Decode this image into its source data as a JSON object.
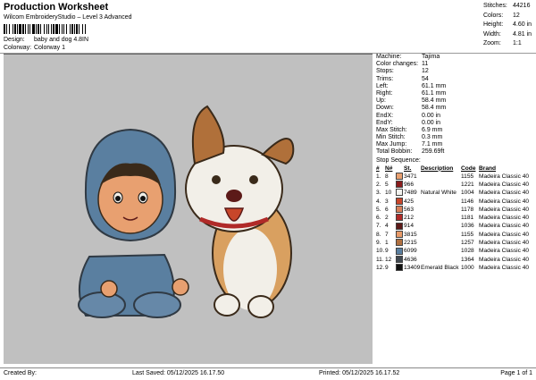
{
  "header": {
    "title": "Production Worksheet",
    "subtitle": "Wilcom EmbroideryStudio – Level 3 Advanced",
    "barcode_text": "",
    "design_label": "Design:",
    "design_value": "baby and dog 4.8IN",
    "colorway_label": "Colorway:",
    "colorway_value": "Colorway 1"
  },
  "stats": [
    {
      "k": "Stitches:",
      "v": "44216"
    },
    {
      "k": "Colors:",
      "v": "12"
    },
    {
      "k": "Height:",
      "v": "4.60 in"
    },
    {
      "k": "Width:",
      "v": "4.81 in"
    },
    {
      "k": "Zoom:",
      "v": "1:1"
    }
  ],
  "properties": [
    {
      "k": "Machine:",
      "v": "Tajima"
    },
    {
      "k": "Color changes:",
      "v": "11"
    },
    {
      "k": "Stops:",
      "v": "12"
    },
    {
      "k": "Trims:",
      "v": "54"
    },
    {
      "k": "Left:",
      "v": "61.1 mm"
    },
    {
      "k": "Right:",
      "v": "61.1 mm"
    },
    {
      "k": "Up:",
      "v": "58.4 mm"
    },
    {
      "k": "Down:",
      "v": "58.4 mm"
    },
    {
      "k": "EndX:",
      "v": "0.00 in"
    },
    {
      "k": "EndY:",
      "v": "0.00 in"
    },
    {
      "k": "Max Stitch:",
      "v": "6.9 mm"
    },
    {
      "k": "Min Stitch:",
      "v": "0.3 mm"
    },
    {
      "k": "Max Jump:",
      "v": "7.1 mm"
    },
    {
      "k": "Total Bobbin:",
      "v": "259.69ft"
    }
  ],
  "sequence": {
    "title": "Stop Sequence:",
    "headers": {
      "num": "#",
      "n": "N#",
      "st": "St.",
      "desc": "Description",
      "code": "Code",
      "brand": "Brand"
    },
    "rows": [
      {
        "num": "1.",
        "n": "8",
        "color": "#e8a070",
        "st": "3471",
        "desc": "",
        "code": "1155",
        "brand": "Madeira Classic 40"
      },
      {
        "num": "2.",
        "n": "5",
        "color": "#8a1c1c",
        "st": "966",
        "desc": "",
        "code": "1221",
        "brand": "Madeira Classic 40"
      },
      {
        "num": "3.",
        "n": "10",
        "color": "#f2f2ee",
        "st": "7489",
        "desc": "Natural White",
        "code": "1004",
        "brand": "Madeira Classic 40"
      },
      {
        "num": "4.",
        "n": "3",
        "color": "#c8462a",
        "st": "425",
        "desc": "",
        "code": "1146",
        "brand": "Madeira Classic 40"
      },
      {
        "num": "5.",
        "n": "6",
        "color": "#d8805a",
        "st": "563",
        "desc": "",
        "code": "1178",
        "brand": "Madeira Classic 40"
      },
      {
        "num": "6.",
        "n": "2",
        "color": "#b02a28",
        "st": "212",
        "desc": "",
        "code": "1181",
        "brand": "Madeira Classic 40"
      },
      {
        "num": "7.",
        "n": "4",
        "color": "#5c1a18",
        "st": "914",
        "desc": "",
        "code": "1036",
        "brand": "Madeira Classic 40"
      },
      {
        "num": "8.",
        "n": "7",
        "color": "#e89a68",
        "st": "3815",
        "desc": "",
        "code": "1155",
        "brand": "Madeira Classic 40"
      },
      {
        "num": "9.",
        "n": "1",
        "color": "#b07040",
        "st": "2215",
        "desc": "",
        "code": "1257",
        "brand": "Madeira Classic 40"
      },
      {
        "num": "10.",
        "n": "9",
        "color": "#5a7fa0",
        "st": "6099",
        "desc": "",
        "code": "1028",
        "brand": "Madeira Classic 40"
      },
      {
        "num": "11.",
        "n": "12",
        "color": "#404850",
        "st": "4636",
        "desc": "",
        "code": "1364",
        "brand": "Madeira Classic 40"
      },
      {
        "num": "12.",
        "n": "9",
        "color": "#101010",
        "st": "13409",
        "desc": "Emerald Black",
        "code": "1000",
        "brand": "Madeira Classic 40"
      }
    ]
  },
  "footer": {
    "created": "Created By:",
    "saved": "Last Saved: 05/12/2025 16.17.50",
    "printed": "Printed: 05/12/2025 16.17.52",
    "page": "Page 1 of 1"
  }
}
